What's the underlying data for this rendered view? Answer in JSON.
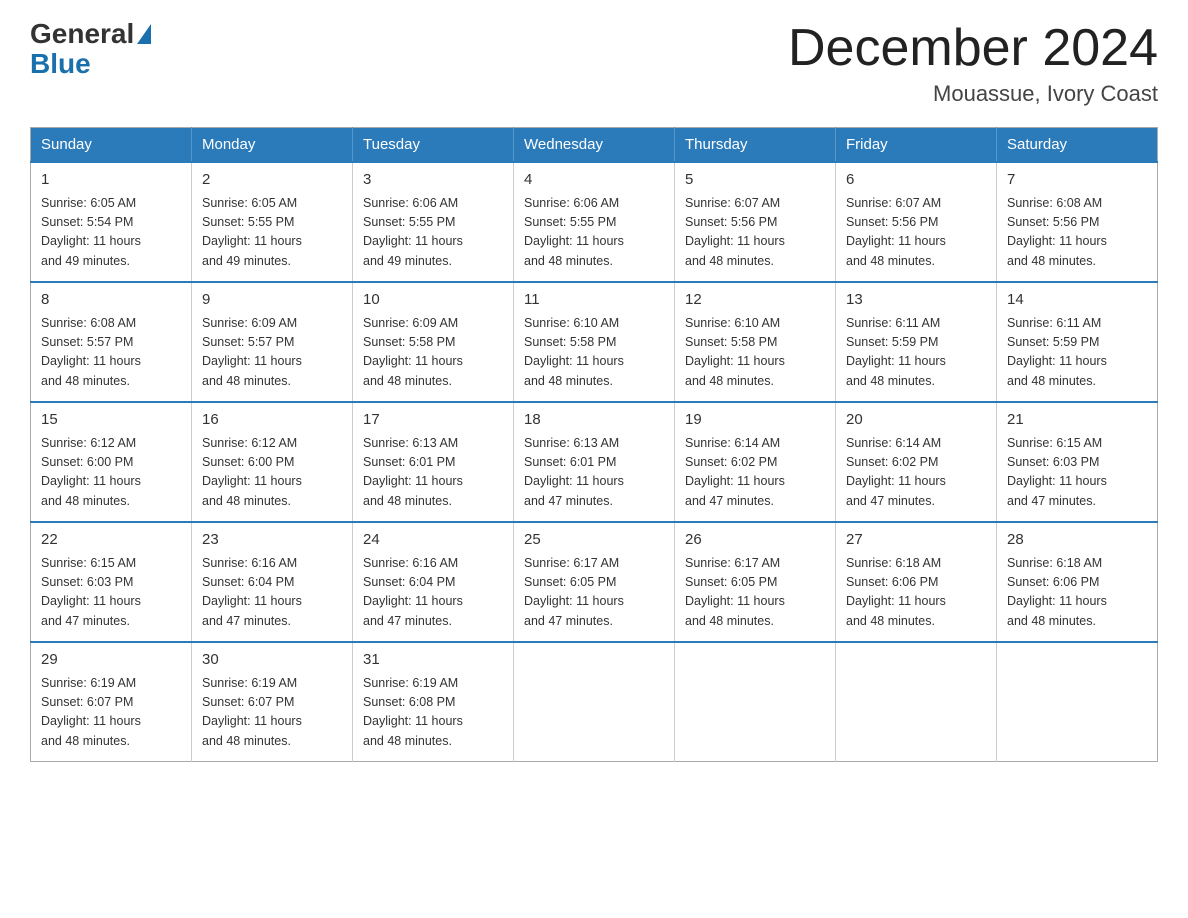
{
  "logo": {
    "general": "General",
    "blue": "Blue"
  },
  "title": "December 2024",
  "location": "Mouassue, Ivory Coast",
  "days_header": [
    "Sunday",
    "Monday",
    "Tuesday",
    "Wednesday",
    "Thursday",
    "Friday",
    "Saturday"
  ],
  "weeks": [
    [
      {
        "day": "1",
        "info": "Sunrise: 6:05 AM\nSunset: 5:54 PM\nDaylight: 11 hours\nand 49 minutes."
      },
      {
        "day": "2",
        "info": "Sunrise: 6:05 AM\nSunset: 5:55 PM\nDaylight: 11 hours\nand 49 minutes."
      },
      {
        "day": "3",
        "info": "Sunrise: 6:06 AM\nSunset: 5:55 PM\nDaylight: 11 hours\nand 49 minutes."
      },
      {
        "day": "4",
        "info": "Sunrise: 6:06 AM\nSunset: 5:55 PM\nDaylight: 11 hours\nand 48 minutes."
      },
      {
        "day": "5",
        "info": "Sunrise: 6:07 AM\nSunset: 5:56 PM\nDaylight: 11 hours\nand 48 minutes."
      },
      {
        "day": "6",
        "info": "Sunrise: 6:07 AM\nSunset: 5:56 PM\nDaylight: 11 hours\nand 48 minutes."
      },
      {
        "day": "7",
        "info": "Sunrise: 6:08 AM\nSunset: 5:56 PM\nDaylight: 11 hours\nand 48 minutes."
      }
    ],
    [
      {
        "day": "8",
        "info": "Sunrise: 6:08 AM\nSunset: 5:57 PM\nDaylight: 11 hours\nand 48 minutes."
      },
      {
        "day": "9",
        "info": "Sunrise: 6:09 AM\nSunset: 5:57 PM\nDaylight: 11 hours\nand 48 minutes."
      },
      {
        "day": "10",
        "info": "Sunrise: 6:09 AM\nSunset: 5:58 PM\nDaylight: 11 hours\nand 48 minutes."
      },
      {
        "day": "11",
        "info": "Sunrise: 6:10 AM\nSunset: 5:58 PM\nDaylight: 11 hours\nand 48 minutes."
      },
      {
        "day": "12",
        "info": "Sunrise: 6:10 AM\nSunset: 5:58 PM\nDaylight: 11 hours\nand 48 minutes."
      },
      {
        "day": "13",
        "info": "Sunrise: 6:11 AM\nSunset: 5:59 PM\nDaylight: 11 hours\nand 48 minutes."
      },
      {
        "day": "14",
        "info": "Sunrise: 6:11 AM\nSunset: 5:59 PM\nDaylight: 11 hours\nand 48 minutes."
      }
    ],
    [
      {
        "day": "15",
        "info": "Sunrise: 6:12 AM\nSunset: 6:00 PM\nDaylight: 11 hours\nand 48 minutes."
      },
      {
        "day": "16",
        "info": "Sunrise: 6:12 AM\nSunset: 6:00 PM\nDaylight: 11 hours\nand 48 minutes."
      },
      {
        "day": "17",
        "info": "Sunrise: 6:13 AM\nSunset: 6:01 PM\nDaylight: 11 hours\nand 48 minutes."
      },
      {
        "day": "18",
        "info": "Sunrise: 6:13 AM\nSunset: 6:01 PM\nDaylight: 11 hours\nand 47 minutes."
      },
      {
        "day": "19",
        "info": "Sunrise: 6:14 AM\nSunset: 6:02 PM\nDaylight: 11 hours\nand 47 minutes."
      },
      {
        "day": "20",
        "info": "Sunrise: 6:14 AM\nSunset: 6:02 PM\nDaylight: 11 hours\nand 47 minutes."
      },
      {
        "day": "21",
        "info": "Sunrise: 6:15 AM\nSunset: 6:03 PM\nDaylight: 11 hours\nand 47 minutes."
      }
    ],
    [
      {
        "day": "22",
        "info": "Sunrise: 6:15 AM\nSunset: 6:03 PM\nDaylight: 11 hours\nand 47 minutes."
      },
      {
        "day": "23",
        "info": "Sunrise: 6:16 AM\nSunset: 6:04 PM\nDaylight: 11 hours\nand 47 minutes."
      },
      {
        "day": "24",
        "info": "Sunrise: 6:16 AM\nSunset: 6:04 PM\nDaylight: 11 hours\nand 47 minutes."
      },
      {
        "day": "25",
        "info": "Sunrise: 6:17 AM\nSunset: 6:05 PM\nDaylight: 11 hours\nand 47 minutes."
      },
      {
        "day": "26",
        "info": "Sunrise: 6:17 AM\nSunset: 6:05 PM\nDaylight: 11 hours\nand 48 minutes."
      },
      {
        "day": "27",
        "info": "Sunrise: 6:18 AM\nSunset: 6:06 PM\nDaylight: 11 hours\nand 48 minutes."
      },
      {
        "day": "28",
        "info": "Sunrise: 6:18 AM\nSunset: 6:06 PM\nDaylight: 11 hours\nand 48 minutes."
      }
    ],
    [
      {
        "day": "29",
        "info": "Sunrise: 6:19 AM\nSunset: 6:07 PM\nDaylight: 11 hours\nand 48 minutes."
      },
      {
        "day": "30",
        "info": "Sunrise: 6:19 AM\nSunset: 6:07 PM\nDaylight: 11 hours\nand 48 minutes."
      },
      {
        "day": "31",
        "info": "Sunrise: 6:19 AM\nSunset: 6:08 PM\nDaylight: 11 hours\nand 48 minutes."
      },
      null,
      null,
      null,
      null
    ]
  ]
}
